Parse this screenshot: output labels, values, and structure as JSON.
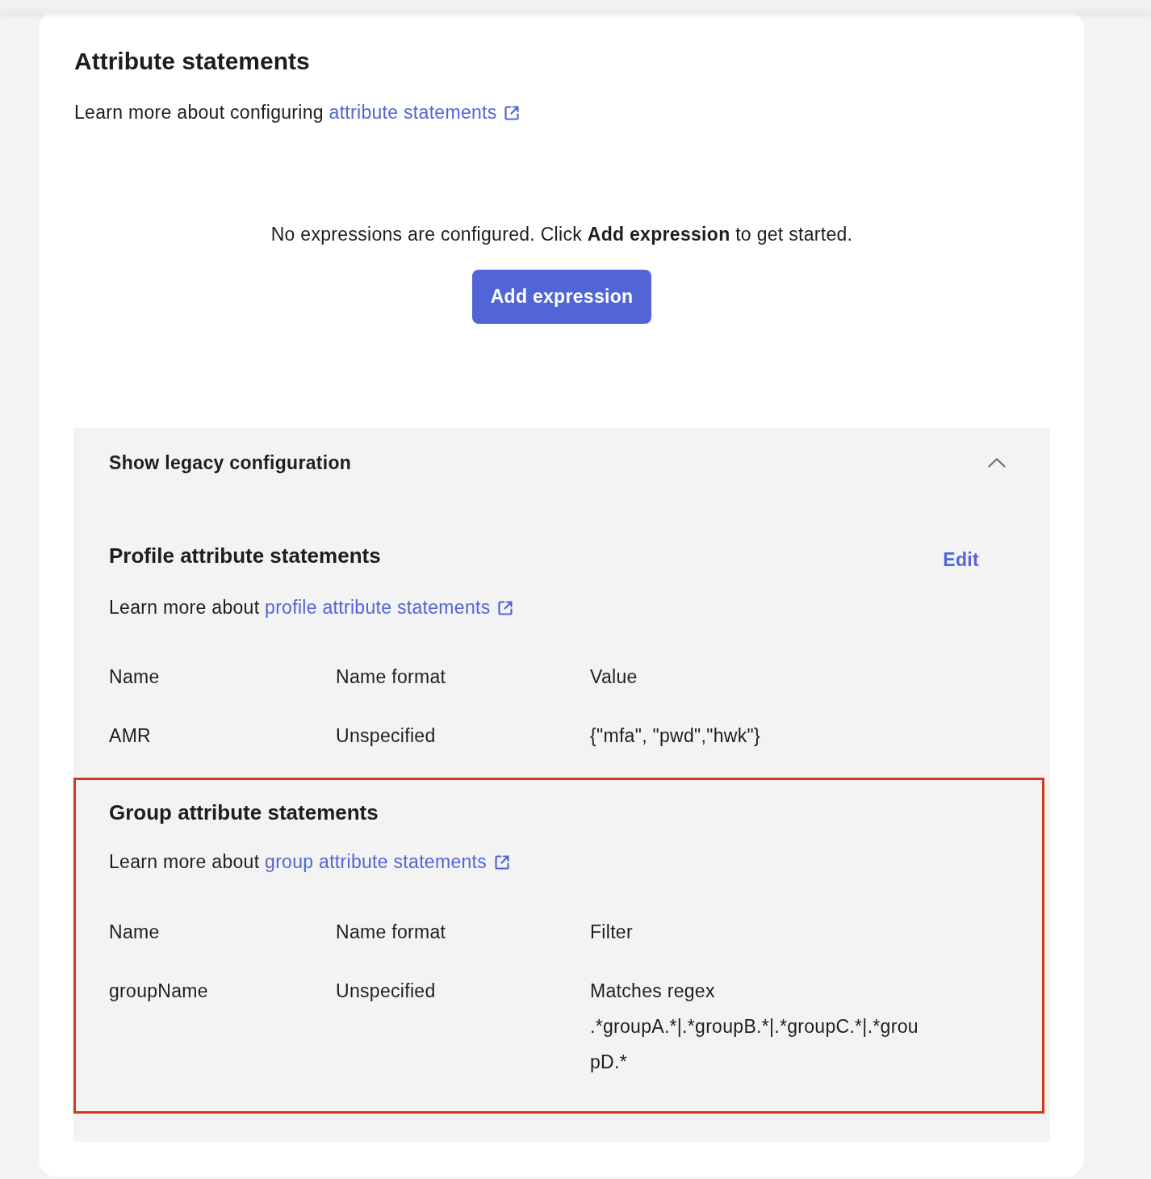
{
  "card": {
    "title": "Attribute statements",
    "learn_more": {
      "text": "Learn more about configuring",
      "link": "attribute statements"
    },
    "empty_message": "No expressions are configured. Click **Add expression** to get started.",
    "add_button": "Add expression"
  },
  "legacy": {
    "title": "Show legacy configuration",
    "expanded": true,
    "sections": [
      {
        "title": "Profile attribute statements",
        "action": "Edit",
        "highlighted": false,
        "learn_more": {
          "text": "Learn more about",
          "link": "profile attribute statements"
        },
        "columns": [
          "Name",
          "Name format",
          "Value"
        ],
        "rows": [
          [
            "AMR",
            "Unspecified",
            "{\"mfa\", \"pwd\",\"hwk\"}"
          ]
        ]
      },
      {
        "title": "Group attribute statements",
        "highlighted": true,
        "learn_more": {
          "text": "Learn more about",
          "link": "group attribute statements"
        },
        "columns": [
          "Name",
          "Name format",
          "Filter"
        ],
        "rows": [
          [
            "groupName",
            "Unspecified",
            {
              "condition": "Matches regex",
              "expression": ".*groupA.*|.*groupB.*|.*groupC.*|.*groupD.*"
            }
          ]
        ]
      }
    ]
  }
}
